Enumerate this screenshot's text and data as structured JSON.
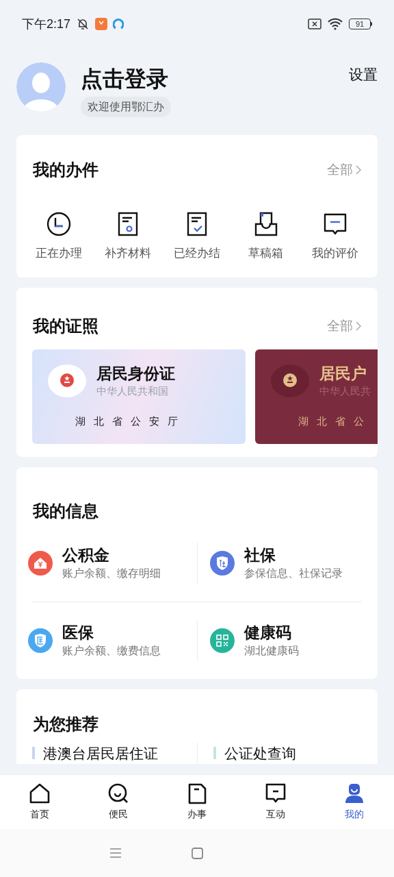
{
  "status_bar": {
    "time": "下午2:17",
    "battery": "91"
  },
  "profile": {
    "login": "点击登录",
    "welcome": "欢迎使用鄂汇办",
    "settings": "设置"
  },
  "my_tasks": {
    "title": "我的办件",
    "all_link": "全部",
    "items": [
      {
        "label": "正在办理"
      },
      {
        "label": "补齐材料"
      },
      {
        "label": "已经办结"
      },
      {
        "label": "草稿箱"
      },
      {
        "label": "我的评价"
      }
    ]
  },
  "my_certificates": {
    "title": "我的证照",
    "all_link": "全部",
    "cards": [
      {
        "kind": "id",
        "title": "居民身份证",
        "country": "中华人民共和国",
        "authority": "湖北省公安厅"
      },
      {
        "kind": "household",
        "title": "居民户",
        "country": "中华人民共",
        "authority": "湖北省公"
      }
    ]
  },
  "my_info": {
    "title": "我的信息",
    "items": [
      {
        "title": "公积金",
        "subtitle": "账户余额、缴存明细",
        "color": "#f05a4a"
      },
      {
        "title": "社保",
        "subtitle": "参保信息、社保记录",
        "color": "#5b7ae0"
      },
      {
        "title": "医保",
        "subtitle": "账户余额、缴费信息",
        "color": "#4aa8f0"
      },
      {
        "title": "健康码",
        "subtitle": "湖北健康码",
        "color": "#26b59a"
      }
    ]
  },
  "recommend": {
    "title": "为您推荐",
    "items": [
      {
        "label": "港澳台居民居住证",
        "color": "#c9d4f0"
      },
      {
        "label": "公证处查询",
        "color": "#bfe8dc"
      }
    ]
  },
  "bottom_nav": [
    {
      "label": "首页",
      "selected": false
    },
    {
      "label": "便民",
      "selected": false
    },
    {
      "label": "办事",
      "selected": false
    },
    {
      "label": "互动",
      "selected": false
    },
    {
      "label": "我的",
      "selected": true
    }
  ]
}
